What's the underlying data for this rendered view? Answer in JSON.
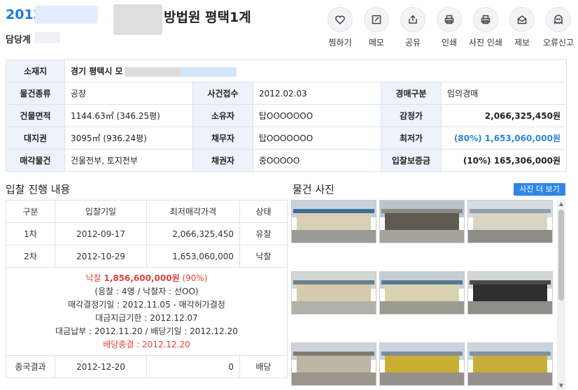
{
  "header": {
    "case_number_visible": "2012",
    "court_visible": "방법원 평택1계",
    "subtitle_visible": "담당계"
  },
  "actions": [
    {
      "label": "찜하기",
      "icon": "heart-icon"
    },
    {
      "label": "메모",
      "icon": "memo-icon"
    },
    {
      "label": "공유",
      "icon": "share-icon"
    },
    {
      "label": "인쇄",
      "icon": "print-icon"
    },
    {
      "label": "사진 인쇄",
      "icon": "photo-print-icon"
    },
    {
      "label": "제보",
      "icon": "report-icon"
    },
    {
      "label": "오류신고",
      "icon": "error-report-icon"
    }
  ],
  "info": {
    "location_label": "소재지",
    "location_value": "경기 평택시 모",
    "type_label": "물건종류",
    "type_value": "공장",
    "received_label": "사건접수",
    "received_value": "2012.02.03",
    "auction_type_label": "경매구분",
    "auction_type_value": "임의경매",
    "building_area_label": "건물면적",
    "building_area_value": "1144.63㎡ (346.25평)",
    "owner_label": "소유자",
    "owner_value": "탑OOOOOOO",
    "appraisal_label": "감정가",
    "appraisal_value": "2,066,325,450원",
    "land_right_label": "대지권",
    "land_right_value": "3095㎡ (936.24평)",
    "debtor_label": "채무자",
    "debtor_value": "탑OOOOOOO",
    "min_price_label": "최저가",
    "min_price_value": "(80%) 1,653,060,000원",
    "sale_object_label": "매각물건",
    "sale_object_value": "건물전부, 토지전부",
    "creditor_label": "채권자",
    "creditor_value": "중OOOOO",
    "deposit_label": "입찰보증금",
    "deposit_value": "(10%) 165,306,000원"
  },
  "bid_section": {
    "title": "입찰 진행 내용",
    "headers": [
      "구분",
      "입찰기일",
      "최저매각가격",
      "상태"
    ],
    "rows": [
      {
        "round": "1차",
        "date": "2012-09-17",
        "price": "2,066,325,450",
        "status": "유찰"
      },
      {
        "round": "2차",
        "date": "2012-10-29",
        "price": "1,653,060,000",
        "status": "낙찰"
      }
    ],
    "result": {
      "winning_label": "낙찰",
      "winning_amount": "1,856,600,000원",
      "winning_pct": "(90%)",
      "bidders": "(응찰 : 4명 / 낙찰자 : 선OO)",
      "decision": "매각결정기일 : 2012.11.05 - 매각허가결정",
      "payment_deadline": "대금지급기한 : 2012.12.07",
      "payment": "대금납부 : 2012.11.20 / 배당기일 : 2012.12.20",
      "dividend_end": "배당종결 : 2012.12.20"
    },
    "final_row": {
      "label": "종국결과",
      "date": "2012-12-20",
      "amount": "0",
      "status": "배당"
    }
  },
  "photo_section": {
    "title": "물건 사진",
    "more_label": "사진 더 보기",
    "photo_count_visible": 9
  },
  "colors": {
    "accent_blue": "#2e86d6",
    "header_bg": "#eef3fb",
    "red": "#e0443a"
  }
}
